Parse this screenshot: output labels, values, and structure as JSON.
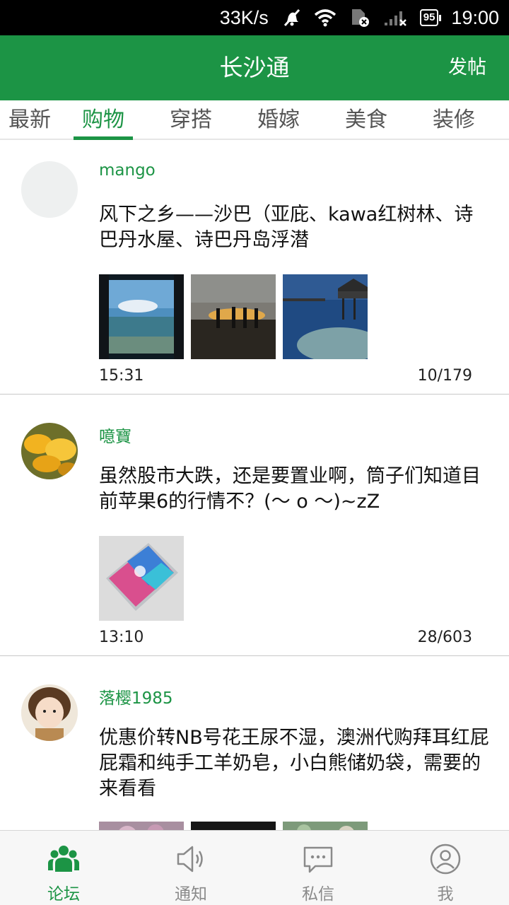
{
  "status_bar": {
    "speed": "33K/s",
    "battery": "95",
    "time": "19:00"
  },
  "header": {
    "title": "长沙通",
    "post_label": "发帖"
  },
  "tabs": [
    {
      "label": "最新"
    },
    {
      "label": "购物"
    },
    {
      "label": "穿搭"
    },
    {
      "label": "婚嫁"
    },
    {
      "label": "美食"
    },
    {
      "label": "装修"
    }
  ],
  "active_tab": "购物",
  "posts": [
    {
      "author": "mango",
      "text": "风下之乡——沙巴（亚庇、kawa红树林、诗巴丹水屋、诗巴丹岛浮潜",
      "time": "15:31",
      "stats": "10/179"
    },
    {
      "author": "噫寶",
      "text": "虽然股市大跌，还是要置业啊，筒子们知道目前苹果6的行情不？(～ o ～)~zZ",
      "time": "13:10",
      "stats": "28/603"
    },
    {
      "author": "落樱1985",
      "text": "优惠价转NB号花王尿不湿，澳洲代购拜耳红屁屁霜和纯手工羊奶皂，小白熊储奶袋，需要的来看看"
    }
  ],
  "bottom_nav": [
    {
      "label": "论坛",
      "icon": "forum-icon"
    },
    {
      "label": "通知",
      "icon": "speaker-icon"
    },
    {
      "label": "私信",
      "icon": "message-icon"
    },
    {
      "label": "我",
      "icon": "profile-icon"
    }
  ],
  "colors": {
    "brand_green": "#1c9445",
    "inactive_gray": "#8a8a8a"
  }
}
